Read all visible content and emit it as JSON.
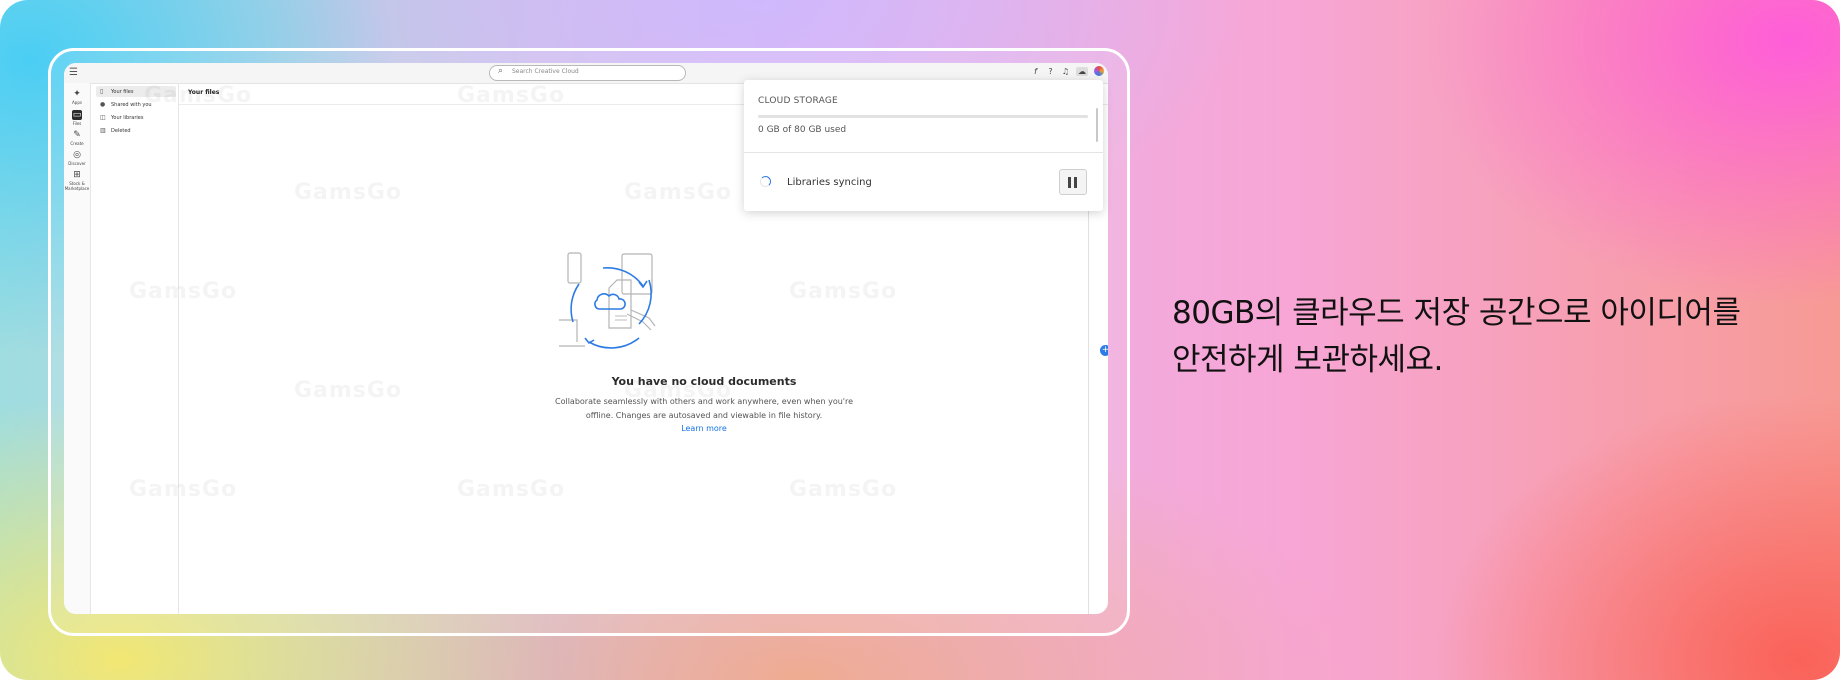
{
  "marketing": {
    "tagline_line1": "80GB의 클라우드 저장 공간으로 아이디어를",
    "tagline_line2": "안전하게 보관하세요."
  },
  "topbar": {
    "search_placeholder": "Search Creative Cloud",
    "icons": [
      "fonts-icon",
      "help-icon",
      "bell-icon",
      "cloud-icon",
      "avatar"
    ]
  },
  "rail": {
    "items": [
      {
        "label": "Apps",
        "icon": "apps-icon"
      },
      {
        "label": "Files",
        "icon": "files-icon",
        "active": true
      },
      {
        "label": "Create",
        "icon": "create-icon"
      },
      {
        "label": "Discover",
        "icon": "discover-icon"
      },
      {
        "label": "Stock & Marketplace",
        "icon": "stock-icon"
      }
    ]
  },
  "sidenav": {
    "items": [
      {
        "label": "Your files",
        "active": true
      },
      {
        "label": "Shared with you"
      },
      {
        "label": "Your libraries"
      },
      {
        "label": "Deleted"
      }
    ]
  },
  "content": {
    "title": "Your files",
    "empty_title": "You have no cloud documents",
    "empty_desc_line1": "Collaborate seamlessly with others and work anywhere, even when you're",
    "empty_desc_line2": "offline. Changes are autosaved and viewable in file history.",
    "learn_more": "Learn more"
  },
  "cloud_storage": {
    "title": "CLOUD STORAGE",
    "used_text": "0 GB of 80 GB used",
    "used_fraction": 0.0,
    "sync_label": "Libraries syncing"
  },
  "watermark": "GamsGo",
  "colors": {
    "accent": "#2d7be4",
    "link": "#1473e6"
  }
}
